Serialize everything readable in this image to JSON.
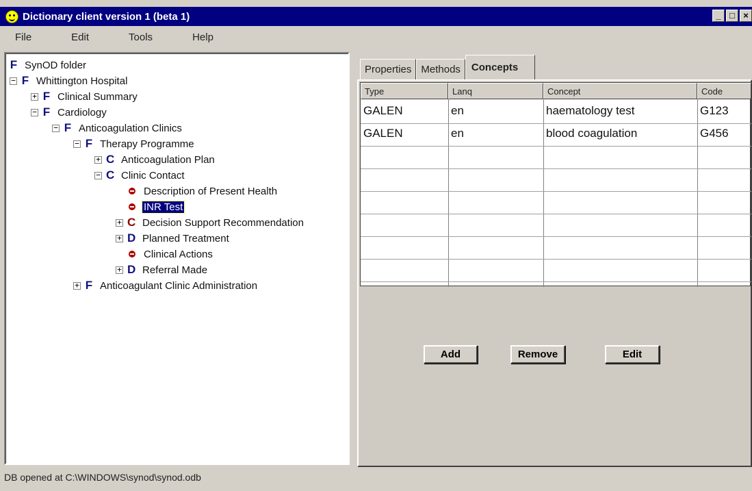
{
  "window": {
    "title": "Dictionary client version 1 (beta 1)",
    "minimize": "_",
    "maximize": "□",
    "close": "×"
  },
  "menu": [
    "File",
    "Edit",
    "Tools",
    "Help"
  ],
  "tree": [
    {
      "depth": 0,
      "kind": "F",
      "label": "SynOD folder",
      "expander": ""
    },
    {
      "depth": 0,
      "kind": "F",
      "label": "Whittington Hospital",
      "expander": "-"
    },
    {
      "depth": 1,
      "kind": "F",
      "label": "Clinical Summary",
      "expander": "+"
    },
    {
      "depth": 1,
      "kind": "F",
      "label": "Cardiology",
      "expander": "-"
    },
    {
      "depth": 2,
      "kind": "F",
      "label": "Anticoagulation Clinics",
      "expander": "-"
    },
    {
      "depth": 3,
      "kind": "F",
      "label": "Therapy Programme",
      "expander": "-"
    },
    {
      "depth": 4,
      "kind": "C",
      "label": "Anticoagulation Plan",
      "expander": "+"
    },
    {
      "depth": 4,
      "kind": "C",
      "label": "Clinic Contact",
      "expander": "-"
    },
    {
      "depth": 5,
      "kind": "e",
      "label": "Description of Present Health",
      "expander": ""
    },
    {
      "depth": 5,
      "kind": "e",
      "label": "INR Test",
      "expander": "",
      "selected": true
    },
    {
      "depth": 5,
      "kind": "C-red",
      "label": "Decision Support Recommendation",
      "expander": "+"
    },
    {
      "depth": 5,
      "kind": "D",
      "label": "Planned Treatment",
      "expander": "+"
    },
    {
      "depth": 5,
      "kind": "e",
      "label": "Clinical Actions",
      "expander": ""
    },
    {
      "depth": 5,
      "kind": "D",
      "label": "Referral Made",
      "expander": "+"
    },
    {
      "depth": 3,
      "kind": "F",
      "label": "Anticoagulant Clinic Administration",
      "expander": "+"
    }
  ],
  "tabs": [
    "Properties",
    "Methods",
    "Concepts"
  ],
  "grid": {
    "headers": [
      "Type",
      "Lanq",
      "Concept",
      "Code"
    ],
    "rows": [
      [
        "GALEN",
        "en",
        "haematology test",
        "G123"
      ],
      [
        "GALEN",
        "en",
        "blood coagulation",
        "G456"
      ]
    ]
  },
  "buttons": {
    "add": "Add",
    "remove": "Remove",
    "edit": "Edit"
  },
  "status": "DB opened at C:\\WINDOWS\\synod\\synod.odb"
}
